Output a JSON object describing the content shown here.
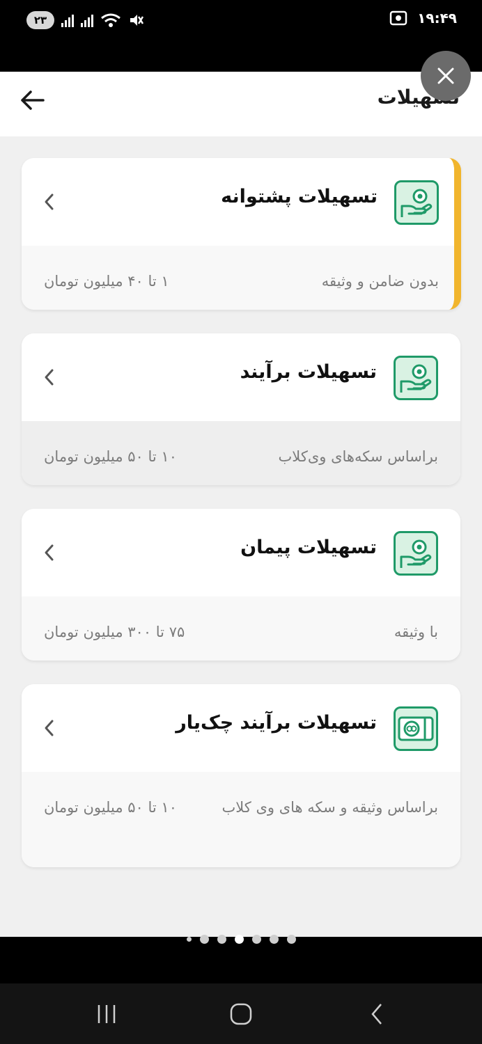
{
  "status_bar": {
    "battery": "۲۳",
    "time": "۱۹:۴۹"
  },
  "app_bar": {
    "title": "تسهیلات"
  },
  "cards": [
    {
      "title": "تسهیلات پشتوانه",
      "condition": "بدون ضامن و وثیقه",
      "range": "۱ تا ۴۰ میلیون تومان",
      "icon": "hand-coin-icon",
      "highlighted": true
    },
    {
      "title": "تسهیلات برآیند",
      "condition": "براساس سکه‌های وی‌کلاب",
      "range": "۱۰ تا ۵۰ میلیون تومان",
      "icon": "hand-coin-icon"
    },
    {
      "title": "تسهیلات پیمان",
      "condition": "با وثیقه",
      "range": "۷۵ تا ۳۰۰ میلیون تومان",
      "icon": "hand-coin-icon"
    },
    {
      "title": "تسهیلات برآیند چک‌یار",
      "condition": "براساس وثیقه و سکه های وی کلاب",
      "range": "۱۰ تا ۵۰ میلیون تومان",
      "icon": "cheque-icon"
    }
  ],
  "accent_color": "#f1b52d",
  "icon_color": "#1f9a68",
  "pager": {
    "count": 7,
    "active_index": 3
  }
}
